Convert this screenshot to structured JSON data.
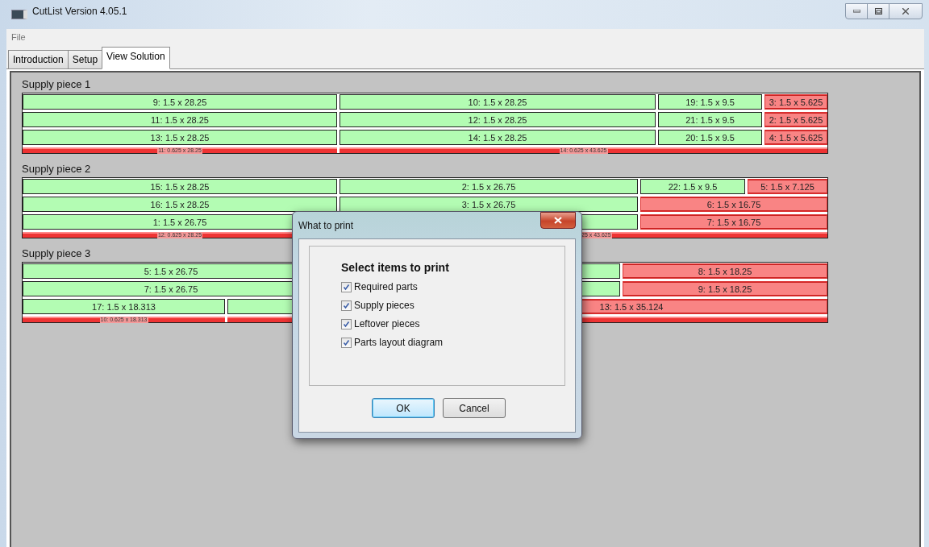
{
  "window": {
    "title": "CutList  Version 4.05.1"
  },
  "menu": [
    "File"
  ],
  "tabs": [
    {
      "label": "Introduction",
      "selected": false
    },
    {
      "label": "Setup",
      "selected": false
    },
    {
      "label": "View Solution",
      "selected": true
    }
  ],
  "supply_pieces": [
    {
      "title": "Supply piece 1",
      "rows": [
        {
          "kind": "parts",
          "pieces": [
            {
              "kind": "part",
              "label": "9: 1.5 x 28.25"
            },
            {
              "kind": "part",
              "label": "10: 1.5 x 28.25"
            },
            {
              "kind": "part",
              "label": "19: 1.5 x 9.5"
            },
            {
              "kind": "leftover",
              "label": "3: 1.5 x 5.625"
            }
          ]
        },
        {
          "kind": "parts",
          "pieces": [
            {
              "kind": "part",
              "label": "11: 1.5 x 28.25"
            },
            {
              "kind": "part",
              "label": "12: 1.5 x 28.25"
            },
            {
              "kind": "part",
              "label": "21: 1.5 x 9.5"
            },
            {
              "kind": "leftover",
              "label": "2: 1.5 x 5.625"
            }
          ]
        },
        {
          "kind": "parts",
          "pieces": [
            {
              "kind": "part",
              "label": "13: 1.5 x 28.25"
            },
            {
              "kind": "part",
              "label": "14: 1.5 x 28.25"
            },
            {
              "kind": "part",
              "label": "20: 1.5 x 9.5"
            },
            {
              "kind": "leftover",
              "label": "4: 1.5 x 5.625"
            }
          ]
        },
        {
          "kind": "strip",
          "pieces": [
            {
              "kind": "leftover",
              "label": "11: 0.625 x 28.25"
            },
            {
              "kind": "leftover",
              "label": "14: 0.625 x 43.625"
            }
          ]
        }
      ]
    },
    {
      "title": "Supply piece 2",
      "rows": [
        {
          "kind": "parts",
          "pieces": [
            {
              "kind": "part",
              "label": "15: 1.5 x 28.25"
            },
            {
              "kind": "part",
              "label": "2: 1.5 x 26.75"
            },
            {
              "kind": "part",
              "label": "22: 1.5 x 9.5"
            },
            {
              "kind": "leftover",
              "label": "5: 1.5 x 7.125"
            }
          ]
        },
        {
          "kind": "parts",
          "pieces": [
            {
              "kind": "part",
              "label": "16: 1.5 x 28.25"
            },
            {
              "kind": "part",
              "label": "3: 1.5 x 26.75"
            },
            {
              "kind": "leftover",
              "label": "6: 1.5 x 16.75"
            }
          ]
        },
        {
          "kind": "parts",
          "pieces": [
            {
              "kind": "part",
              "label": "1: 1.5 x 26.75"
            },
            {
              "kind": "part"
            },
            {
              "kind": "leftover",
              "label": "7: 1.5 x 16.75"
            }
          ]
        },
        {
          "kind": "strip",
          "pieces": [
            {
              "kind": "leftover",
              "label": "12: 0.625 x 28.25"
            },
            {
              "kind": "leftover",
              "label": "25 x 43.625"
            }
          ]
        }
      ]
    },
    {
      "title": "Supply piece 3",
      "rows": [
        {
          "kind": "parts",
          "pieces": [
            {
              "kind": "part",
              "label": "5: 1.5 x 26.75"
            },
            {
              "kind": "part"
            },
            {
              "kind": "leftover",
              "label": "8: 1.5 x 18.25"
            }
          ]
        },
        {
          "kind": "parts",
          "pieces": [
            {
              "kind": "part",
              "label": "7: 1.5 x 26.75"
            },
            {
              "kind": "part"
            },
            {
              "kind": "leftover",
              "label": "9: 1.5 x 18.25"
            }
          ]
        },
        {
          "kind": "parts",
          "pieces": [
            {
              "kind": "part",
              "label": "17: 1.5 x 18.313"
            },
            {
              "kind": "part"
            },
            {
              "kind": "leftover",
              "label": "13: 1.5 x 35.124"
            }
          ]
        },
        {
          "kind": "strip",
          "pieces": [
            {
              "kind": "leftover",
              "label": "10: 0.625 x 18.313"
            },
            {
              "kind": "leftover"
            }
          ]
        }
      ]
    }
  ],
  "dialog": {
    "title": "What to print",
    "heading": "Select items to print",
    "options": [
      {
        "label": "Required parts",
        "checked": true
      },
      {
        "label": "Supply pieces",
        "checked": true
      },
      {
        "label": "Leftover pieces",
        "checked": true
      },
      {
        "label": "Parts layout diagram",
        "checked": true
      }
    ],
    "buttons": [
      {
        "label": "OK",
        "focused": true
      },
      {
        "label": "Cancel",
        "focused": false
      }
    ]
  }
}
